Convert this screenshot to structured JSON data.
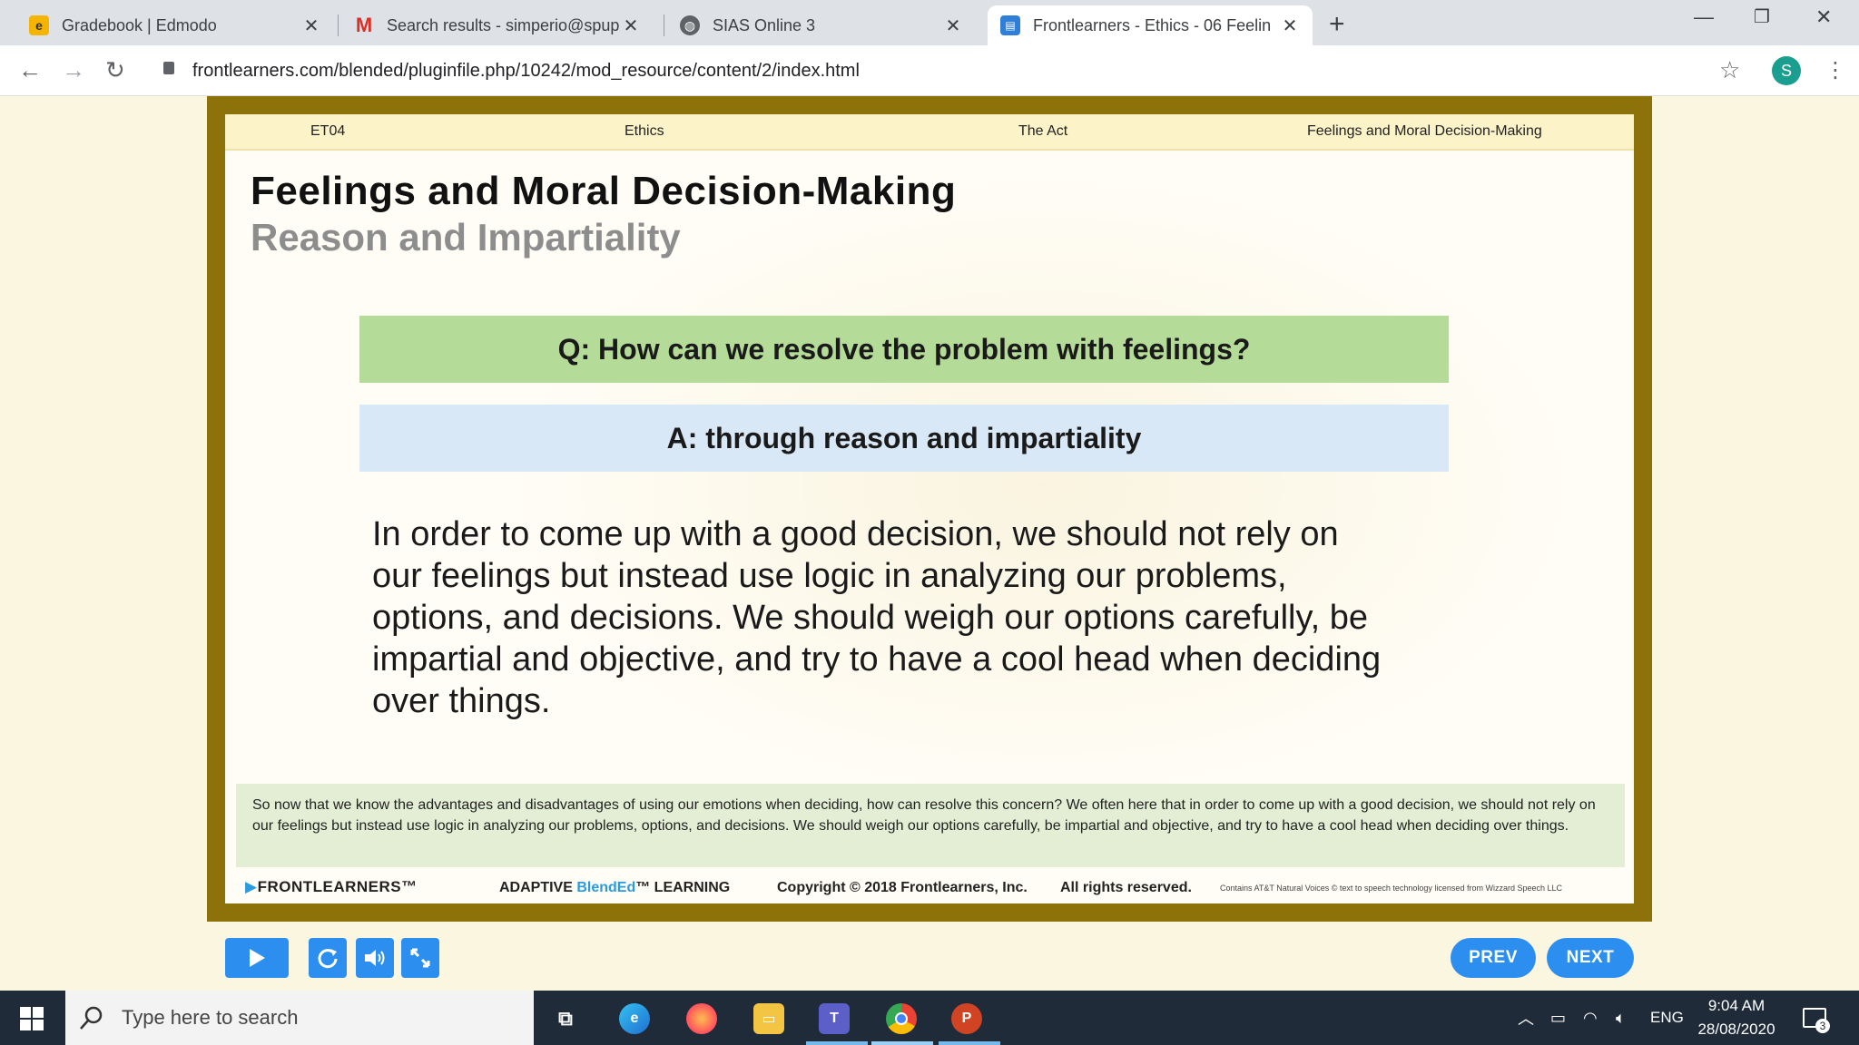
{
  "browser": {
    "tabs": [
      {
        "title": "Gradebook | Edmodo",
        "favicon": "edmodo-icon",
        "active": false
      },
      {
        "title": "Search results - simperio@spup.e",
        "favicon": "gmail-icon",
        "active": false
      },
      {
        "title": "SIAS Online 3",
        "favicon": "globe-icon",
        "active": false
      },
      {
        "title": "Frontlearners - Ethics - 06 Feelin",
        "favicon": "frontlearners-icon",
        "active": true
      }
    ],
    "url": "frontlearners.com/blended/pluginfile.php/10242/mod_resource/content/2/index.html",
    "profile_initial": "S"
  },
  "slide": {
    "breadcrumbs": [
      "ET04",
      "Ethics",
      "The Act",
      "Feelings and Moral Decision-Making"
    ],
    "title": "Feelings and Moral Decision-Making",
    "subtitle": "Reason and Impartiality",
    "question": "Q: How can we resolve the problem with feelings?",
    "answer": "A: through reason and impartiality",
    "body": "In order to come up with a good decision, we should not rely on our feelings but instead use logic in analyzing our problems, options, and decisions.  We should weigh our options carefully, be impartial and objective, and try to have a cool head when deciding over things.",
    "narration": "So now that we know the advantages and disadvantages of using our emotions when deciding, how can resolve this concern? We often here that in order to come up with a good decision, we should not rely on our feelings but instead use logic in analyzing our problems, options, and decisions.  We should weigh our options carefully, be impartial and objective, and try to have a cool head when deciding over things.",
    "footer": {
      "brand": "FRONTLEARNERS",
      "adaptive_pre": "ADAPTIVE ",
      "adaptive_blend": "BlendEd",
      "adaptive_post": "™ LEARNING",
      "copyright": "Copyright © 2018  Frontlearners, Inc.",
      "rights": "All rights reserved.",
      "voices": "Contains AT&T Natural Voices © text to speech technology licensed from Wizzard Speech LLC"
    }
  },
  "player": {
    "prev_label": "PREV",
    "next_label": "NEXT"
  },
  "taskbar": {
    "search_placeholder": "Type here to search",
    "language": "ENG",
    "time": "9:04 AM",
    "date": "28/08/2020",
    "notification_count": "3"
  },
  "colors": {
    "frame": "#8c7208",
    "question_bg": "#b5db98",
    "answer_bg": "#d8e8f6",
    "narration_bg": "#e3eed4",
    "button_blue": "#2c8ff0"
  }
}
